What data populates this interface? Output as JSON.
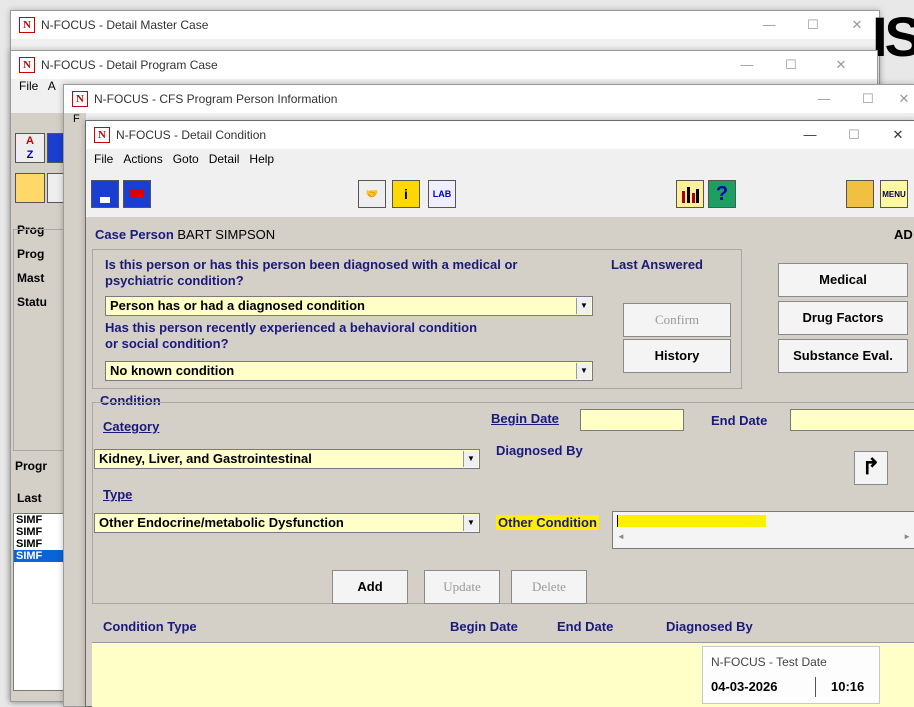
{
  "bg_windows": {
    "master": {
      "title": "N-FOCUS - Detail Master Case"
    },
    "program": {
      "title": "N-FOCUS - Detail Program Case"
    },
    "cfs": {
      "title": "N-FOCUS - CFS Program Person Information"
    },
    "program_menu": [
      "File",
      "A"
    ],
    "big_letters": "IS",
    "left_labels": [
      "Prog",
      "Prog",
      "Mast",
      "Statu",
      "Progr",
      "Last"
    ],
    "list_items": [
      "SIMF",
      "SIMF",
      "SIMF",
      "SIMF"
    ],
    "pane_letters": [
      "F",
      "F"
    ]
  },
  "window": {
    "title": "N-FOCUS - Detail Condition",
    "menu": [
      "File",
      "Actions",
      "Goto",
      "Detail",
      "Help"
    ],
    "toolbar": {
      "lab_label": "LAB",
      "menu_label": "MENU"
    }
  },
  "case_person": {
    "label": "Case Person",
    "name": "BART SIMPSON",
    "right_code": "AD"
  },
  "q1": {
    "text_line1": "Is this person or has this person been diagnosed with a medical or",
    "text_line2": "psychiatric condition?",
    "value": "Person has or had a diagnosed condition"
  },
  "q2": {
    "text_line1": "Has this person recently experienced a behavioral condition",
    "text_line2": "or social condition?",
    "value": "No known condition"
  },
  "last_answered_label": "Last Answered",
  "buttons": {
    "confirm": "Confirm",
    "history": "History",
    "medical": "Medical",
    "drug_factors": "Drug Factors",
    "substance_eval": "Substance Eval.",
    "add": "Add",
    "update": "Update",
    "delete": "Delete"
  },
  "condition": {
    "group_label": "Condition",
    "category_label": "Category",
    "category_value": "Kidney, Liver, and Gastrointestinal",
    "begin_date_label": "Begin Date",
    "end_date_label": "End Date",
    "diagnosed_by_label": "Diagnosed By",
    "type_label": "Type",
    "type_value": "Other Endocrine/metabolic Dysfunction",
    "other_condition_label": "Other Condition",
    "other_condition_value": ""
  },
  "table_headers": [
    "Condition Type",
    "Begin Date",
    "End Date",
    "Diagnosed By"
  ],
  "status": {
    "label": "N-FOCUS - Test Date",
    "date": "04-03-2026",
    "time": "10:16"
  },
  "colors": {
    "label_blue": "#1a1a7a",
    "field_yellow": "#ffffc8",
    "highlight_yellow": "#ffef00",
    "selected_row": "#0a64d8"
  }
}
